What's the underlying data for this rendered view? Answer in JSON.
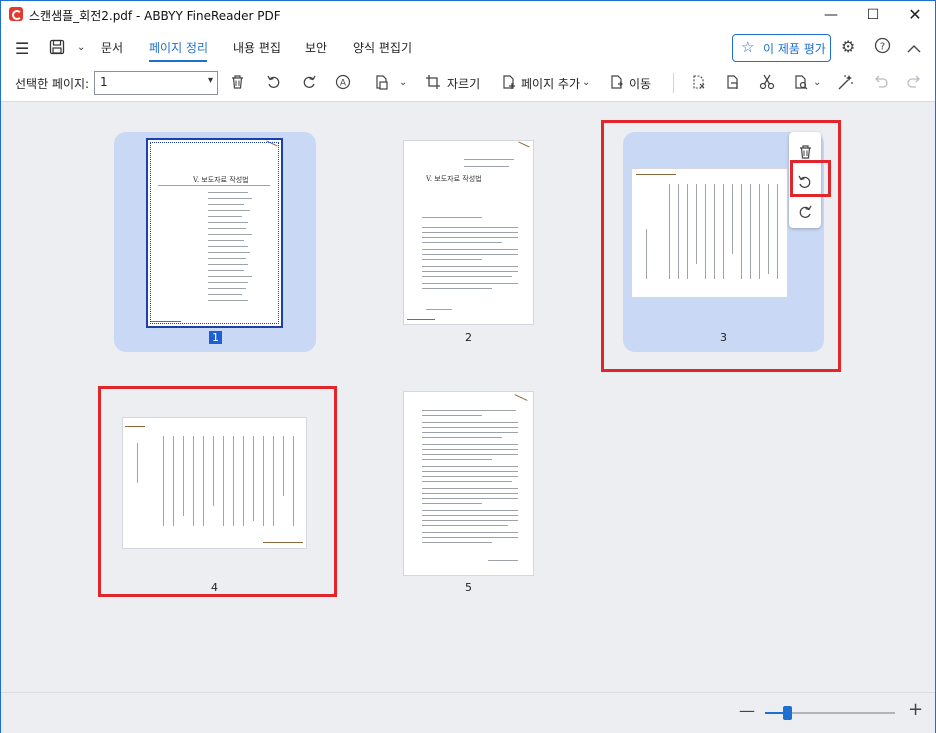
{
  "window": {
    "title": "스캔샘플_회전2.pdf - ABBYY FineReader PDF",
    "controls": {
      "minimize": "—",
      "maximize": "☐",
      "close": "✕"
    }
  },
  "menu": {
    "tabs": [
      {
        "label": "문서"
      },
      {
        "label": "페이지 정리"
      },
      {
        "label": "내용 편집"
      },
      {
        "label": "보안"
      },
      {
        "label": "양식 편집기"
      }
    ],
    "active_tab": "페이지 정리",
    "rate_button": "이 제품 평가"
  },
  "toolbar": {
    "selected_pages_label": "선택한 페이지:",
    "selected_pages_value": "1",
    "crop_label": "자르기",
    "add_page_label": "페이지 추가",
    "move_label": "이동"
  },
  "pages": [
    {
      "number": "1",
      "selected": true,
      "title": "V. 보도자료 작성법"
    },
    {
      "number": "2",
      "selected": false,
      "title": "V. 보도자료 작성법"
    },
    {
      "number": "3",
      "selected": false,
      "rotated": true,
      "hover": true
    },
    {
      "number": "4",
      "selected": false,
      "rotated": true
    },
    {
      "number": "5",
      "selected": false
    }
  ],
  "zoom": {
    "level": 0.17
  },
  "colors": {
    "accent": "#1f6fd1",
    "highlight_red": "#e0262b",
    "selection_bg": "#c9d8f5"
  },
  "icons": [
    "hamburger-menu-icon",
    "save-icon",
    "chevron-down-icon",
    "star-icon",
    "settings-icon",
    "help-icon",
    "collapse-icon",
    "trash-icon",
    "rotate-left-icon",
    "rotate-right-icon",
    "ocr-icon",
    "extract-icon",
    "crop-icon",
    "add-page-icon",
    "move-page-icon",
    "replace-page-icon",
    "split-icon",
    "cut-icon",
    "page-recognize-icon",
    "magic-icon",
    "undo-icon",
    "redo-icon"
  ]
}
